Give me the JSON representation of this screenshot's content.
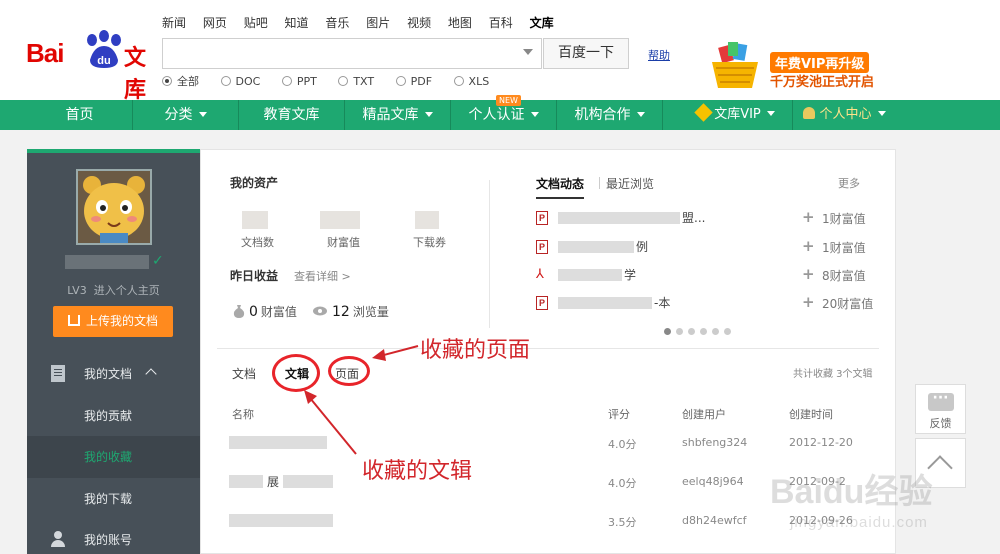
{
  "header": {
    "logo": "Bai文库",
    "top_nav": [
      "新闻",
      "网页",
      "贴吧",
      "知道",
      "音乐",
      "图片",
      "视频",
      "地图",
      "百科",
      "文库"
    ],
    "search_placeholder": "",
    "search_button": "百度一下",
    "help": "帮助",
    "filters": [
      "全部",
      "DOC",
      "PPT",
      "TXT",
      "PDF",
      "XLS"
    ],
    "promo_line1": "年费VIP再升级",
    "promo_line2": "千万奖池正式开启"
  },
  "greenbar": {
    "items": [
      "首页",
      "分类",
      "教育文库",
      "精品文库",
      "个人认证",
      "机构合作",
      "文库VIP",
      "个人中心"
    ],
    "new_tag": "NEW",
    "color": "#1ea871"
  },
  "sidebar": {
    "level": "LV3",
    "home_link": "进入个人主页",
    "upload": "上传我的文档",
    "my_docs": "我的文档",
    "contrib": "我的贡献",
    "fav": "我的收藏",
    "download": "我的下载",
    "account": "我的账号"
  },
  "assets": {
    "title": "我的资产",
    "labels": [
      "文档数",
      "财富值",
      "下载券"
    ],
    "yesterday": "昨日收益",
    "detail": "查看详细 >",
    "wealth_val": "0",
    "wealth_label": "财富值",
    "views_val": "12",
    "views_label": "浏览量"
  },
  "feed": {
    "tab_active": "文档动态",
    "tab_other": "最近浏览",
    "more": "更多",
    "rows": [
      {
        "suffix": "盟...",
        "value": "1财富值"
      },
      {
        "suffix": "例",
        "value": "1财富值"
      },
      {
        "suffix": "学",
        "value": "8财富值"
      },
      {
        "suffix": "-本",
        "value": "20财富值"
      }
    ]
  },
  "collections": {
    "tabs": [
      "文档",
      "文辑",
      "页面"
    ],
    "count_text": "共计收藏 3个文辑",
    "headers": [
      "名称",
      "评分",
      "创建用户",
      "创建时间"
    ],
    "rows": [
      {
        "name_suffix": "",
        "score": "4.0分",
        "user": "shbfeng324",
        "time": "2012-12-20"
      },
      {
        "name_suffix": "展",
        "score": "4.0分",
        "user": "eelq48j964",
        "time": "2012-09-2"
      },
      {
        "name_suffix": "",
        "score": "3.5分",
        "user": "d8h24ewfcf",
        "time": "2012-09-26"
      }
    ]
  },
  "annotations": {
    "page": "收藏的页面",
    "album": "收藏的文辑"
  },
  "side_tools": {
    "feedback": "反馈"
  },
  "watermark": {
    "line1": "Baidu经验",
    "line2": "jingyan.baidu.com"
  }
}
